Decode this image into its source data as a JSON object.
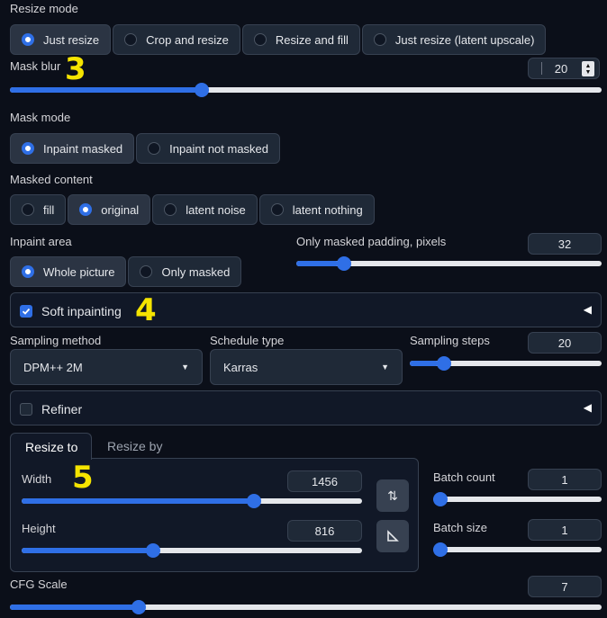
{
  "resize_mode": {
    "label": "Resize mode",
    "options": [
      "Just resize",
      "Crop and resize",
      "Resize and fill",
      "Just resize (latent upscale)"
    ],
    "selected": 0
  },
  "mask_blur": {
    "label": "Mask blur",
    "value": "20",
    "slider_fraction": 0.32
  },
  "mask_mode": {
    "label": "Mask mode",
    "options": [
      "Inpaint masked",
      "Inpaint not masked"
    ],
    "selected": 0
  },
  "masked_content": {
    "label": "Masked content",
    "options": [
      "fill",
      "original",
      "latent noise",
      "latent nothing"
    ],
    "selected": 1
  },
  "inpaint_area": {
    "label": "Inpaint area",
    "options": [
      "Whole picture",
      "Only masked"
    ],
    "selected": 0
  },
  "only_masked_padding": {
    "label": "Only masked padding, pixels",
    "value": "32",
    "slider_fraction": 0.14
  },
  "soft_inpainting": {
    "label": "Soft inpainting",
    "checked": true
  },
  "sampling_method": {
    "label": "Sampling method",
    "value": "DPM++ 2M"
  },
  "schedule_type": {
    "label": "Schedule type",
    "value": "Karras"
  },
  "sampling_steps": {
    "label": "Sampling steps",
    "value": "20",
    "slider_fraction": 0.15
  },
  "refiner": {
    "label": "Refiner",
    "checked": false
  },
  "resize_tabs": [
    "Resize to",
    "Resize by"
  ],
  "width": {
    "label": "Width",
    "value": "1456",
    "slider_fraction": 0.69
  },
  "height": {
    "label": "Height",
    "value": "816",
    "slider_fraction": 0.38
  },
  "batch_count": {
    "label": "Batch count",
    "value": "1",
    "slider_fraction": 0.0
  },
  "batch_size": {
    "label": "Batch size",
    "value": "1",
    "slider_fraction": 0.0
  },
  "cfg_scale": {
    "label": "CFG Scale",
    "value": "7",
    "slider_fraction": 0.21
  },
  "annotations": [
    "3",
    "4",
    "5"
  ],
  "icons": {
    "swap": "swap-arrows-icon",
    "aspect": "aspect-ratio-icon",
    "collapse": "collapse-triangle-icon",
    "check": "checkmark-icon"
  },
  "colors": {
    "accent": "#2f6fe6",
    "background": "#0b0f19",
    "annotation": "#f5e400"
  }
}
